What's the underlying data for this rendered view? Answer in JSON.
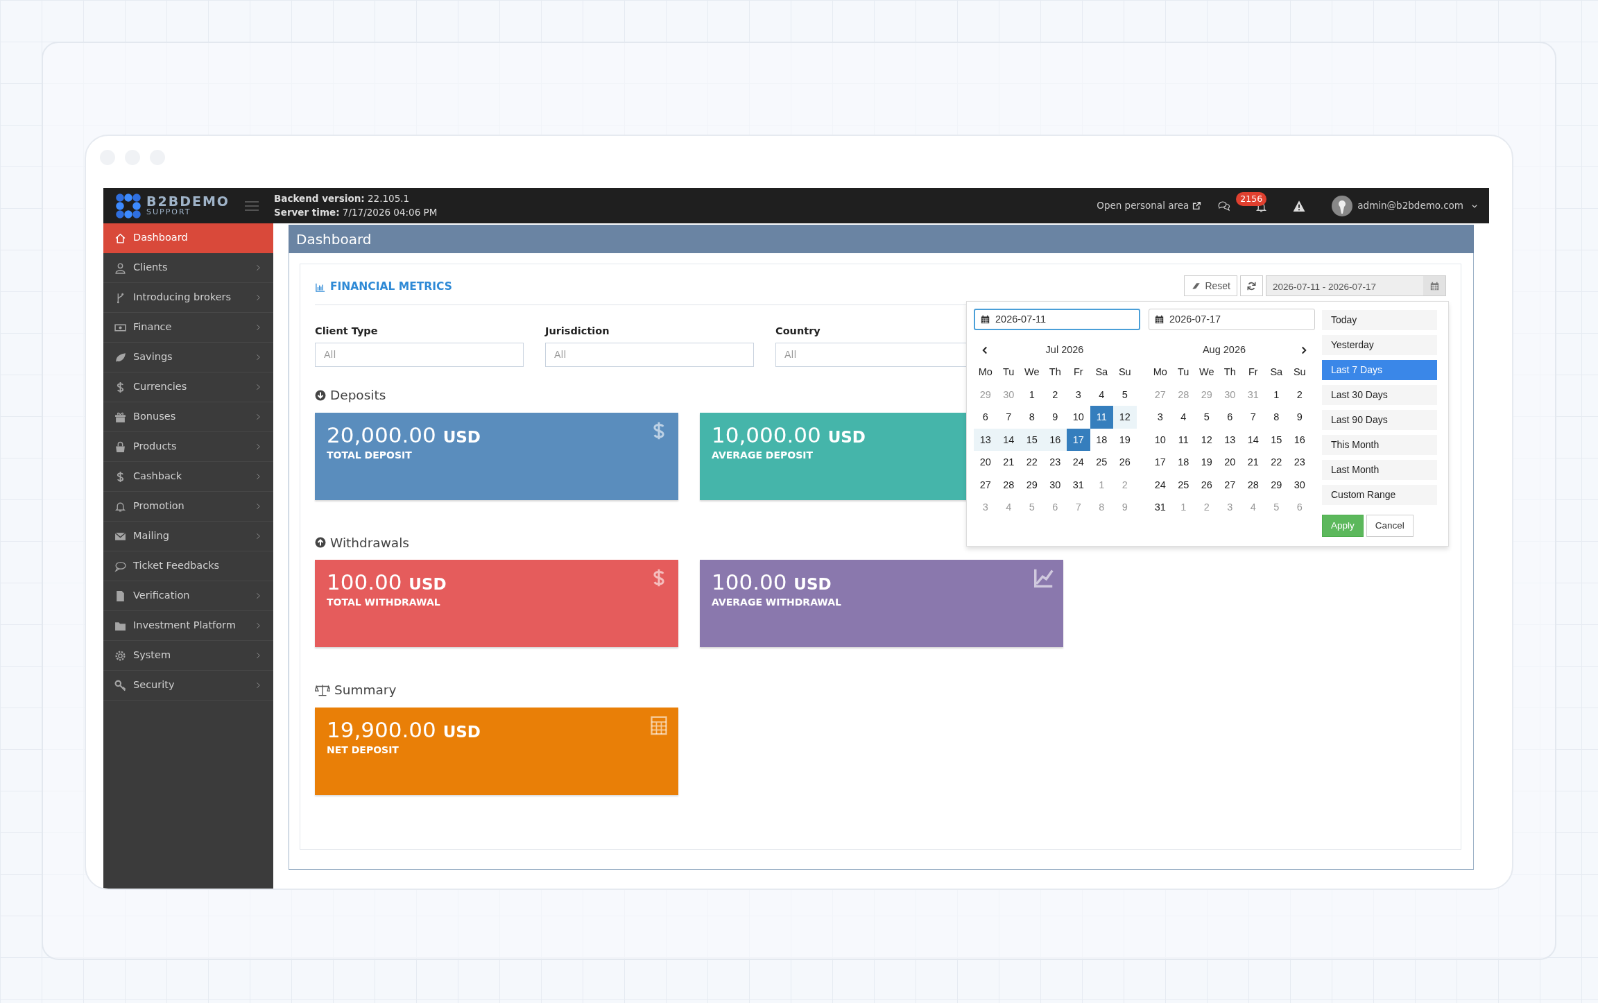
{
  "header": {
    "logo_title": "B2BDEMO",
    "logo_subtitle": "SUPPORT",
    "backend_label": "Backend version:",
    "backend_value": "22.105.1",
    "server_label": "Server time:",
    "server_value": "7/17/2026 04:06 PM",
    "personal_area": "Open personal area",
    "notification_count": "2156",
    "user": "admin@b2bdemo.com"
  },
  "sidebar": {
    "items": [
      {
        "label": "Dashboard",
        "selected": true,
        "submenu": false
      },
      {
        "label": "Clients",
        "selected": false,
        "submenu": true
      },
      {
        "label": "Introducing brokers",
        "selected": false,
        "submenu": true
      },
      {
        "label": "Finance",
        "selected": false,
        "submenu": true
      },
      {
        "label": "Savings",
        "selected": false,
        "submenu": true
      },
      {
        "label": "Currencies",
        "selected": false,
        "submenu": true
      },
      {
        "label": "Bonuses",
        "selected": false,
        "submenu": true
      },
      {
        "label": "Products",
        "selected": false,
        "submenu": true
      },
      {
        "label": "Cashback",
        "selected": false,
        "submenu": true
      },
      {
        "label": "Promotion",
        "selected": false,
        "submenu": true
      },
      {
        "label": "Mailing",
        "selected": false,
        "submenu": true
      },
      {
        "label": "Ticket Feedbacks",
        "selected": false,
        "submenu": false
      },
      {
        "label": "Verification",
        "selected": false,
        "submenu": true
      },
      {
        "label": "Investment Platform",
        "selected": false,
        "submenu": true
      },
      {
        "label": "System",
        "selected": false,
        "submenu": true
      },
      {
        "label": "Security",
        "selected": false,
        "submenu": true
      }
    ]
  },
  "page_title": "Dashboard",
  "panel": {
    "title": "FINANCIAL METRICS",
    "reset": "Reset",
    "date_range": "2026-07-11 - 2026-07-17",
    "filters": [
      {
        "label": "Client Type",
        "placeholder": "All"
      },
      {
        "label": "Jurisdiction",
        "placeholder": "All"
      },
      {
        "label": "Country",
        "placeholder": "All"
      }
    ],
    "sections": [
      {
        "title": "Deposits",
        "cards": [
          {
            "amount": "20,000.00",
            "currency": "USD",
            "label": "TOTAL DEPOSIT",
            "color": "#5a8dbd"
          },
          {
            "amount": "10,000.00",
            "currency": "USD",
            "label": "AVERAGE DEPOSIT",
            "color": "#45b5aa"
          }
        ]
      },
      {
        "title": "Withdrawals",
        "cards": [
          {
            "amount": "100.00",
            "currency": "USD",
            "label": "TOTAL WITHDRAWAL",
            "color": "#e55c5c"
          },
          {
            "amount": "100.00",
            "currency": "USD",
            "label": "AVERAGE WITHDRAWAL",
            "color": "#8a78ad"
          }
        ]
      },
      {
        "title": "Summary",
        "cards": [
          {
            "amount": "19,900.00",
            "currency": "USD",
            "label": "NET DEPOSIT",
            "color": "#e97f07"
          }
        ]
      }
    ]
  },
  "date_picker": {
    "start": "2026-07-11",
    "end": "2026-07-17",
    "calendars": [
      {
        "month": "Jul 2026",
        "weekdays": [
          "Mo",
          "Tu",
          "We",
          "Th",
          "Fr",
          "Sa",
          "Su"
        ],
        "weeks": [
          [
            {
              "day": "29",
              "other_month": true,
              "selected": false,
              "in_range": false
            },
            {
              "day": "30",
              "other_month": true,
              "selected": false,
              "in_range": false
            },
            {
              "day": "1",
              "other_month": false,
              "selected": false,
              "in_range": false
            },
            {
              "day": "2",
              "other_month": false,
              "selected": false,
              "in_range": false
            },
            {
              "day": "3",
              "other_month": false,
              "selected": false,
              "in_range": false
            },
            {
              "day": "4",
              "other_month": false,
              "selected": false,
              "in_range": false
            },
            {
              "day": "5",
              "other_month": false,
              "selected": false,
              "in_range": false
            }
          ],
          [
            {
              "day": "6",
              "other_month": false,
              "selected": false,
              "in_range": false
            },
            {
              "day": "7",
              "other_month": false,
              "selected": false,
              "in_range": false
            },
            {
              "day": "8",
              "other_month": false,
              "selected": false,
              "in_range": false
            },
            {
              "day": "9",
              "other_month": false,
              "selected": false,
              "in_range": false
            },
            {
              "day": "10",
              "other_month": false,
              "selected": false,
              "in_range": false
            },
            {
              "day": "11",
              "other_month": false,
              "selected": true,
              "in_range": false
            },
            {
              "day": "12",
              "other_month": false,
              "selected": false,
              "in_range": true
            }
          ],
          [
            {
              "day": "13",
              "other_month": false,
              "selected": false,
              "in_range": true
            },
            {
              "day": "14",
              "other_month": false,
              "selected": false,
              "in_range": true
            },
            {
              "day": "15",
              "other_month": false,
              "selected": false,
              "in_range": true
            },
            {
              "day": "16",
              "other_month": false,
              "selected": false,
              "in_range": true
            },
            {
              "day": "17",
              "other_month": false,
              "selected": true,
              "in_range": false
            },
            {
              "day": "18",
              "other_month": false,
              "selected": false,
              "in_range": false
            },
            {
              "day": "19",
              "other_month": false,
              "selected": false,
              "in_range": false
            }
          ],
          [
            {
              "day": "20",
              "other_month": false,
              "selected": false,
              "in_range": false
            },
            {
              "day": "21",
              "other_month": false,
              "selected": false,
              "in_range": false
            },
            {
              "day": "22",
              "other_month": false,
              "selected": false,
              "in_range": false
            },
            {
              "day": "23",
              "other_month": false,
              "selected": false,
              "in_range": false
            },
            {
              "day": "24",
              "other_month": false,
              "selected": false,
              "in_range": false
            },
            {
              "day": "25",
              "other_month": false,
              "selected": false,
              "in_range": false
            },
            {
              "day": "26",
              "other_month": false,
              "selected": false,
              "in_range": false
            }
          ],
          [
            {
              "day": "27",
              "other_month": false,
              "selected": false,
              "in_range": false
            },
            {
              "day": "28",
              "other_month": false,
              "selected": false,
              "in_range": false
            },
            {
              "day": "29",
              "other_month": false,
              "selected": false,
              "in_range": false
            },
            {
              "day": "30",
              "other_month": false,
              "selected": false,
              "in_range": false
            },
            {
              "day": "31",
              "other_month": false,
              "selected": false,
              "in_range": false
            },
            {
              "day": "1",
              "other_month": true,
              "selected": false,
              "in_range": false
            },
            {
              "day": "2",
              "other_month": true,
              "selected": false,
              "in_range": false
            }
          ],
          [
            {
              "day": "3",
              "other_month": true,
              "selected": false,
              "in_range": false
            },
            {
              "day": "4",
              "other_month": true,
              "selected": false,
              "in_range": false
            },
            {
              "day": "5",
              "other_month": true,
              "selected": false,
              "in_range": false
            },
            {
              "day": "6",
              "other_month": true,
              "selected": false,
              "in_range": false
            },
            {
              "day": "7",
              "other_month": true,
              "selected": false,
              "in_range": false
            },
            {
              "day": "8",
              "other_month": true,
              "selected": false,
              "in_range": false
            },
            {
              "day": "9",
              "other_month": true,
              "selected": false,
              "in_range": false
            }
          ]
        ]
      },
      {
        "month": "Aug 2026",
        "weekdays": [
          "Mo",
          "Tu",
          "We",
          "Th",
          "Fr",
          "Sa",
          "Su"
        ],
        "weeks": [
          [
            {
              "day": "27",
              "other_month": true,
              "selected": false,
              "in_range": false
            },
            {
              "day": "28",
              "other_month": true,
              "selected": false,
              "in_range": false
            },
            {
              "day": "29",
              "other_month": true,
              "selected": false,
              "in_range": false
            },
            {
              "day": "30",
              "other_month": true,
              "selected": false,
              "in_range": false
            },
            {
              "day": "31",
              "other_month": true,
              "selected": false,
              "in_range": false
            },
            {
              "day": "1",
              "other_month": false,
              "selected": false,
              "in_range": false
            },
            {
              "day": "2",
              "other_month": false,
              "selected": false,
              "in_range": false
            }
          ],
          [
            {
              "day": "3",
              "other_month": false,
              "selected": false,
              "in_range": false
            },
            {
              "day": "4",
              "other_month": false,
              "selected": false,
              "in_range": false
            },
            {
              "day": "5",
              "other_month": false,
              "selected": false,
              "in_range": false
            },
            {
              "day": "6",
              "other_month": false,
              "selected": false,
              "in_range": false
            },
            {
              "day": "7",
              "other_month": false,
              "selected": false,
              "in_range": false
            },
            {
              "day": "8",
              "other_month": false,
              "selected": false,
              "in_range": false
            },
            {
              "day": "9",
              "other_month": false,
              "selected": false,
              "in_range": false
            }
          ],
          [
            {
              "day": "10",
              "other_month": false,
              "selected": false,
              "in_range": false
            },
            {
              "day": "11",
              "other_month": false,
              "selected": false,
              "in_range": false
            },
            {
              "day": "12",
              "other_month": false,
              "selected": false,
              "in_range": false
            },
            {
              "day": "13",
              "other_month": false,
              "selected": false,
              "in_range": false
            },
            {
              "day": "14",
              "other_month": false,
              "selected": false,
              "in_range": false
            },
            {
              "day": "15",
              "other_month": false,
              "selected": false,
              "in_range": false
            },
            {
              "day": "16",
              "other_month": false,
              "selected": false,
              "in_range": false
            }
          ],
          [
            {
              "day": "17",
              "other_month": false,
              "selected": false,
              "in_range": false
            },
            {
              "day": "18",
              "other_month": false,
              "selected": false,
              "in_range": false
            },
            {
              "day": "19",
              "other_month": false,
              "selected": false,
              "in_range": false
            },
            {
              "day": "20",
              "other_month": false,
              "selected": false,
              "in_range": false
            },
            {
              "day": "21",
              "other_month": false,
              "selected": false,
              "in_range": false
            },
            {
              "day": "22",
              "other_month": false,
              "selected": false,
              "in_range": false
            },
            {
              "day": "23",
              "other_month": false,
              "selected": false,
              "in_range": false
            }
          ],
          [
            {
              "day": "24",
              "other_month": false,
              "selected": false,
              "in_range": false
            },
            {
              "day": "25",
              "other_month": false,
              "selected": false,
              "in_range": false
            },
            {
              "day": "26",
              "other_month": false,
              "selected": false,
              "in_range": false
            },
            {
              "day": "27",
              "other_month": false,
              "selected": false,
              "in_range": false
            },
            {
              "day": "28",
              "other_month": false,
              "selected": false,
              "in_range": false
            },
            {
              "day": "29",
              "other_month": false,
              "selected": false,
              "in_range": false
            },
            {
              "day": "30",
              "other_month": false,
              "selected": false,
              "in_range": false
            }
          ],
          [
            {
              "day": "31",
              "other_month": false,
              "selected": false,
              "in_range": false
            },
            {
              "day": "1",
              "other_month": true,
              "selected": false,
              "in_range": false
            },
            {
              "day": "2",
              "other_month": true,
              "selected": false,
              "in_range": false
            },
            {
              "day": "3",
              "other_month": true,
              "selected": false,
              "in_range": false
            },
            {
              "day": "4",
              "other_month": true,
              "selected": false,
              "in_range": false
            },
            {
              "day": "5",
              "other_month": true,
              "selected": false,
              "in_range": false
            },
            {
              "day": "6",
              "other_month": true,
              "selected": false,
              "in_range": false
            }
          ]
        ]
      }
    ],
    "ranges": [
      {
        "label": "Today",
        "selected": false
      },
      {
        "label": "Yesterday",
        "selected": false
      },
      {
        "label": "Last 7 Days",
        "selected": true
      },
      {
        "label": "Last 30 Days",
        "selected": false
      },
      {
        "label": "Last 90 Days",
        "selected": false
      },
      {
        "label": "This Month",
        "selected": false
      },
      {
        "label": "Last Month",
        "selected": false
      },
      {
        "label": "Custom Range",
        "selected": false
      }
    ],
    "apply": "Apply",
    "cancel": "Cancel"
  }
}
